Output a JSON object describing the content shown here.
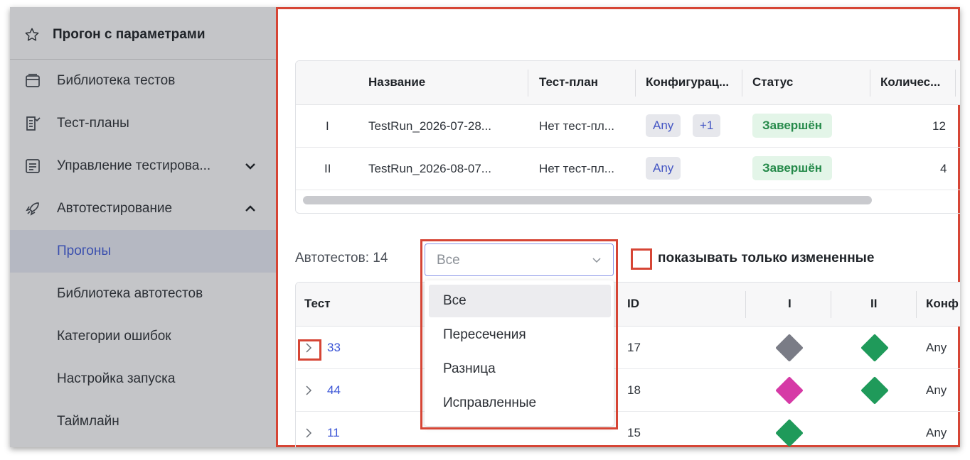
{
  "sidebar": {
    "title": "Прогон с параметрами",
    "items": [
      {
        "label": "Библиотека тестов",
        "icon": "library-icon"
      },
      {
        "label": "Тест-планы",
        "icon": "test-plans-icon"
      },
      {
        "label": "Управление тестирова...",
        "icon": "management-icon",
        "chevron": "down"
      },
      {
        "label": "Автотестирование",
        "icon": "rocket-icon",
        "chevron": "up"
      },
      {
        "label": "Прогоны",
        "active": true
      },
      {
        "label": "Библиотека автотестов"
      },
      {
        "label": "Категории ошибок"
      },
      {
        "label": "Настройка запуска"
      },
      {
        "label": "Таймлайн"
      }
    ]
  },
  "runs_table": {
    "headers": [
      "Название",
      "Тест-план",
      "Конфигурац...",
      "Статус",
      "Количес..."
    ],
    "rows": [
      {
        "index": "I",
        "name": "TestRun_2026-07-28...",
        "plan": "Нет тест-пл...",
        "configs": [
          "Any",
          "+1"
        ],
        "status": "Завершён",
        "count": "12"
      },
      {
        "index": "II",
        "name": "TestRun_2026-08-07...",
        "plan": "Нет тест-пл...",
        "configs": [
          "Any"
        ],
        "status": "Завершён",
        "count": "4"
      }
    ]
  },
  "filters": {
    "autotests_label": "Автотестов: 14",
    "select_value": "Все",
    "options": [
      "Все",
      "Пересечения",
      "Разница",
      "Исправленные"
    ],
    "only_changed_label": "показывать только измененные"
  },
  "tests_table": {
    "headers": [
      "Тест",
      "ID",
      "I",
      "II",
      "Конф"
    ],
    "rows": [
      {
        "test": "33",
        "id": "17",
        "run1": "grey",
        "run2": "green",
        "config": "Any"
      },
      {
        "test": "44",
        "id": "18",
        "run1": "magenta",
        "run2": "green",
        "config": "Any"
      },
      {
        "test": "11",
        "id": "15",
        "run1": "green",
        "run2": "",
        "config": "Any"
      }
    ]
  },
  "colors": {
    "grey": "#7a7c86",
    "green": "#1f9a5a",
    "magenta": "#d63aa6",
    "highlight": "#d64535",
    "link": "#3b55d6"
  }
}
